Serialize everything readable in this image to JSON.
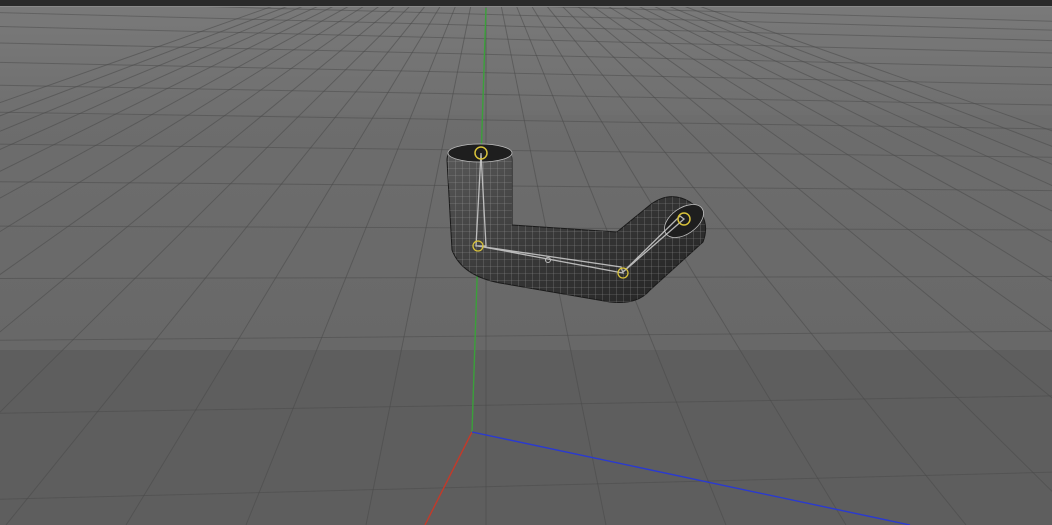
{
  "viewport": {
    "view_name": "3D viewport",
    "background_color": "#5b5b5b",
    "grid_color": "#4a4a4a",
    "axis_colors": {
      "x": "#c23a2a",
      "y": "#3aa03a",
      "z": "#2a3ad0"
    }
  },
  "scene": {
    "object": {
      "name": "bent-tube-mesh",
      "shading": "wireframe-on-shaded",
      "mesh_color": "#2b2b2b"
    },
    "rig": {
      "joint_count": 4,
      "joint_color": "#d8c23a",
      "bone_color": "#d0d0d0"
    }
  }
}
